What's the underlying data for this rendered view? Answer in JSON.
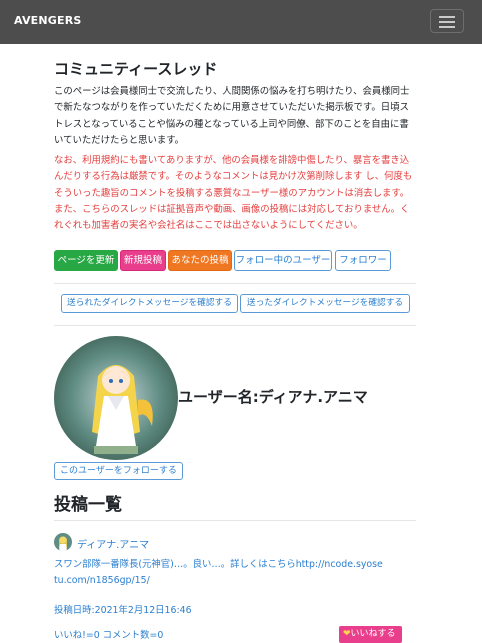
{
  "nav": {
    "brand": "AVENGERS"
  },
  "page": {
    "title": "コミュニティースレッド",
    "intro": "このページは会員様同士で交流したり、人間関係の悩みを打ち明けたり、会員様同士で新たなつながりを作っていただくために用意させていただいた掲示板です。日頃ストレスとなっていることや悩みの種となっている上司や同僚、部下のことを自由に書いていただけたらと思います。",
    "notice": "なお、利用規約にも書いてありますが、他の会員様を誹謗中傷したり、暴言を書き込んだりする行為は厳禁です。そのようなコメントは見かけ次第削除します し、何度もそういった趣旨のコメントを投稿する悪質なユーザー様のアカウントは消去します。また、こちらのスレッドは証拠音声や動画、画像の投稿には対応しておりません。くれぐれも加害者の実名や会社名はここでは出さないようにしてください。"
  },
  "buttons": {
    "refresh": "ページを更新",
    "new_post": "新規投稿",
    "your_posts": "あなたの投稿",
    "following": "フォロー中のユーザー",
    "followers": "フォロワー",
    "sent_dm": "送られたダイレクトメッセージを確認する",
    "send_dm": "送ったダイレクトメッセージを確認する"
  },
  "profile": {
    "username": "ユーザー名:ディアナ.アニマ",
    "follow_button": "このユーザーをフォローする"
  },
  "posts": {
    "title": "投稿一覧",
    "items": [
      {
        "author": "ディアナ.アニマ",
        "body": "スワン部隊一番隊長(元神官)…。良い…。詳しくはこちらhttp://ncode.syosetu.com/n1856gp/15/",
        "date": "投稿日時:2021年2月12日16:46",
        "stats": "いいね!=0 コメント数=0",
        "like_button": "いいねする"
      }
    ]
  },
  "colors": {
    "navbar": "#4d4d4d",
    "link": "#2b7fd0",
    "notice": "#e53e3e",
    "green": "#28a745",
    "magenta": "#e83e8c",
    "orange": "#f07722"
  }
}
